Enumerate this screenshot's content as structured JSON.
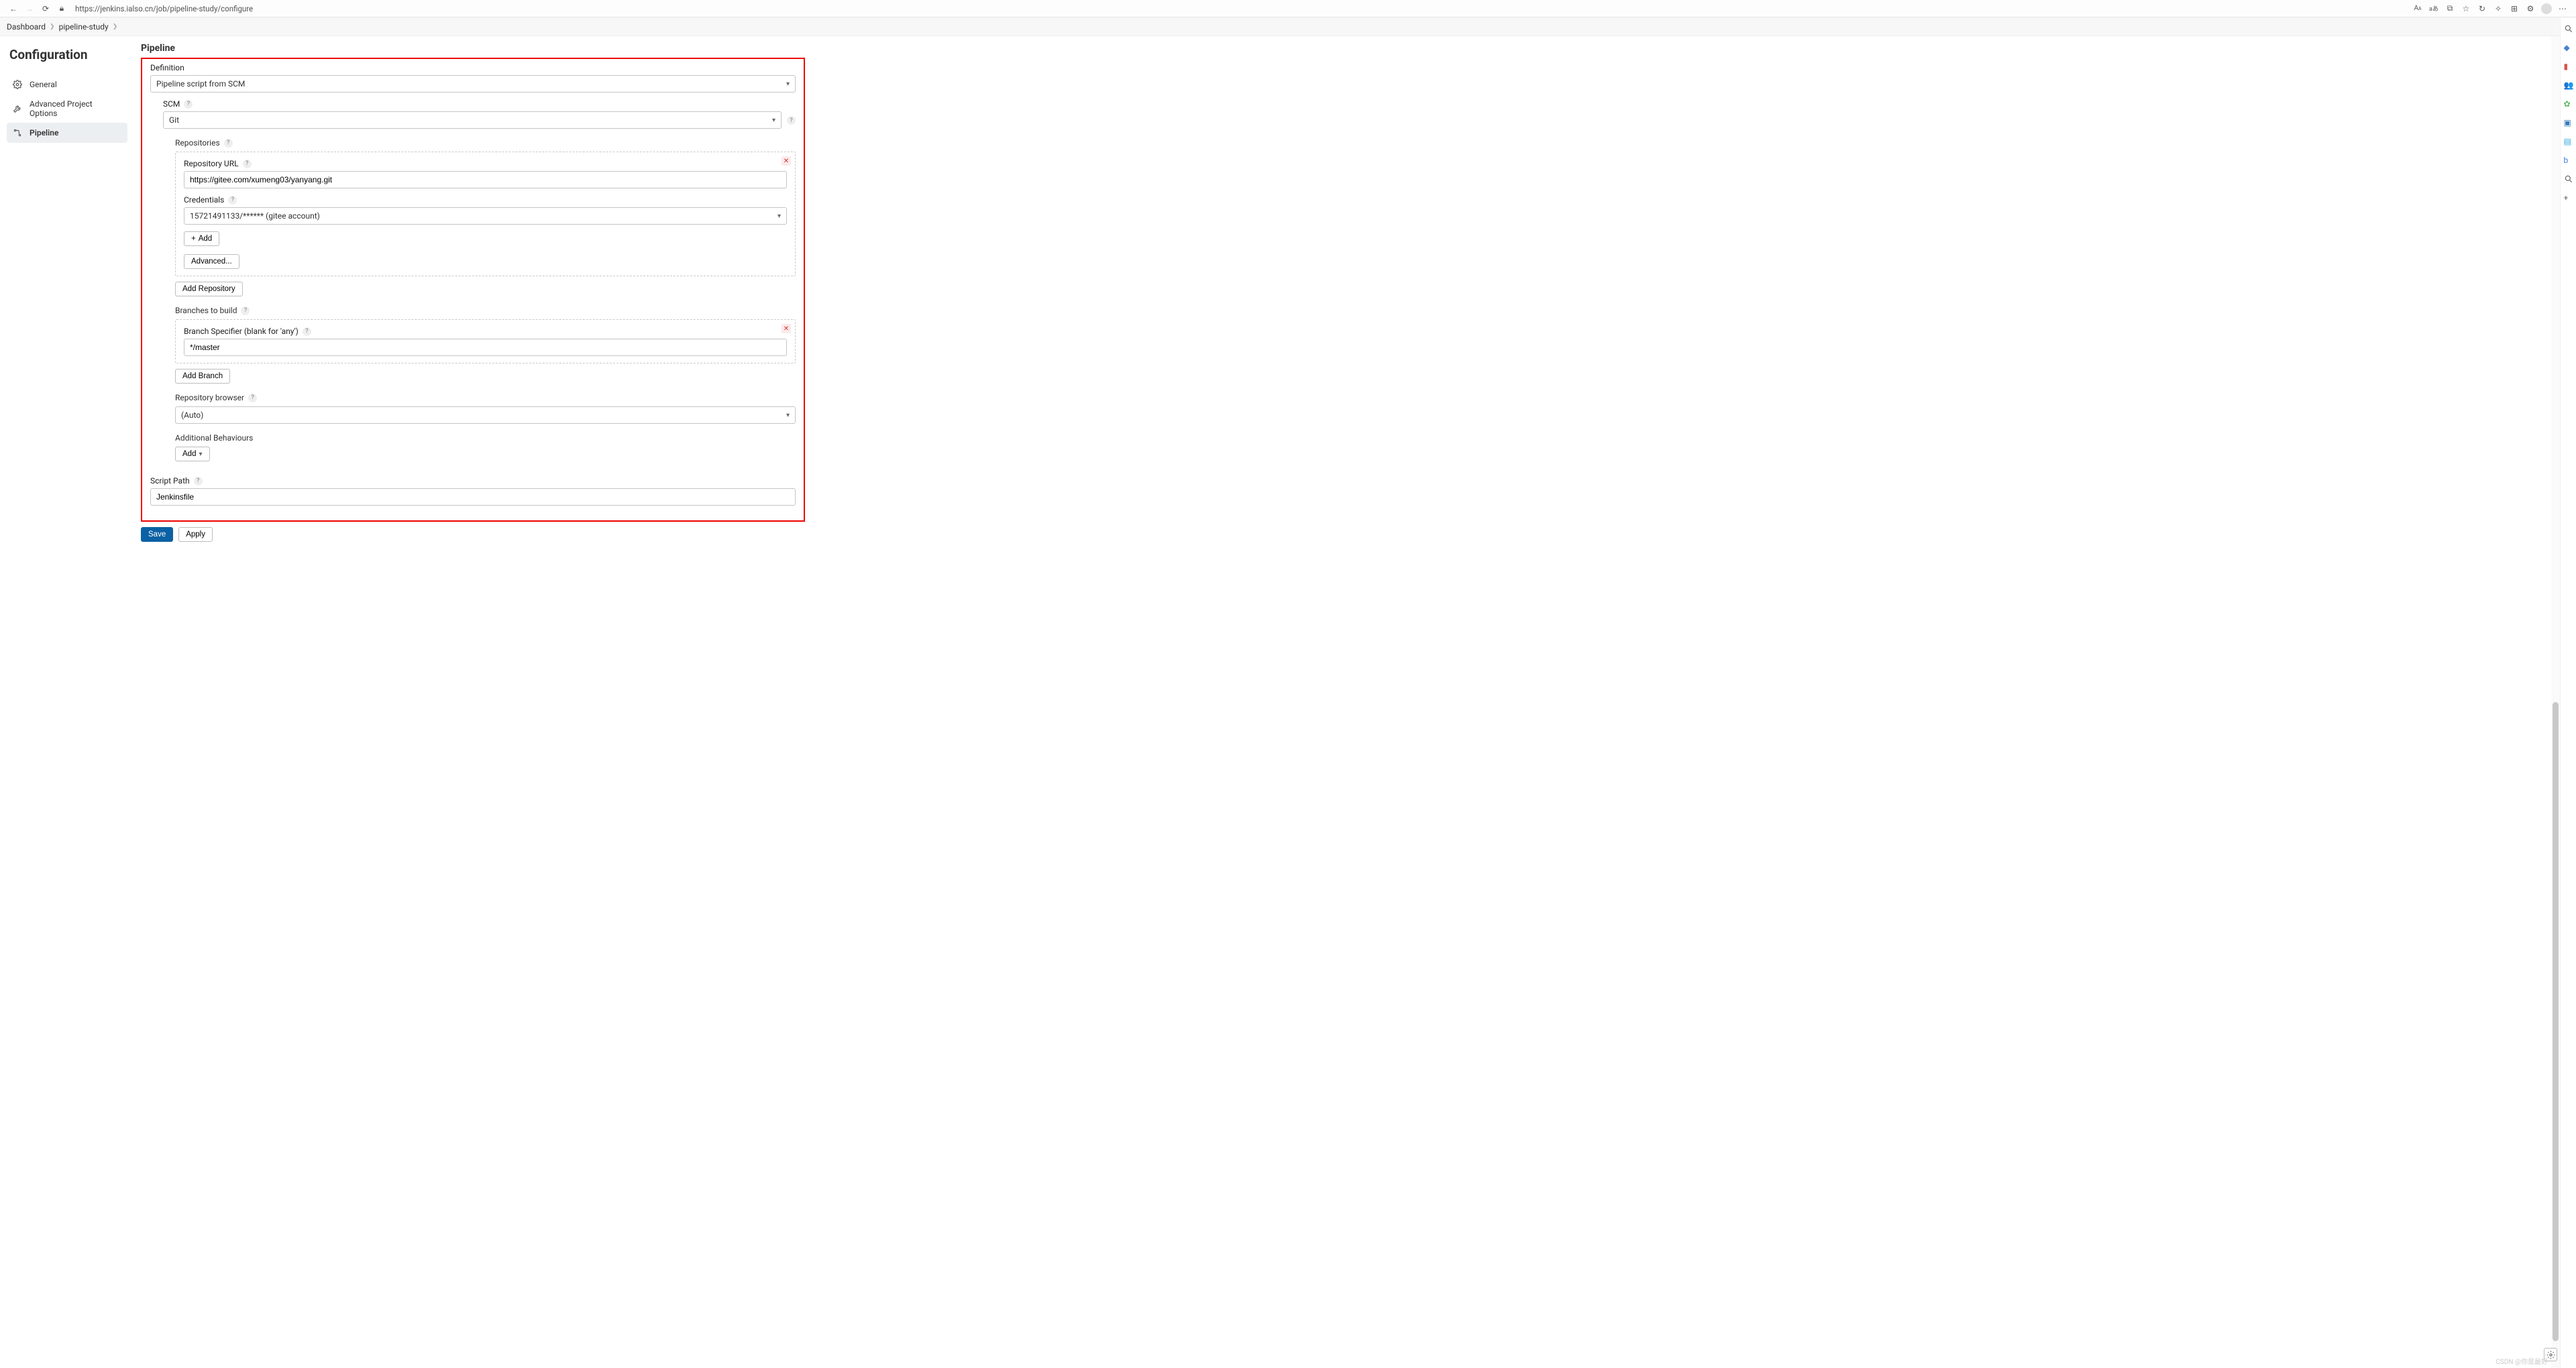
{
  "browser": {
    "url": "https://jenkins.ialso.cn/job/pipeline-study/configure"
  },
  "breadcrumb": {
    "dashboard": "Dashboard",
    "job": "pipeline-study"
  },
  "sidebar": {
    "title": "Configuration",
    "general": "General",
    "advanced": "Advanced Project Options",
    "pipeline": "Pipeline"
  },
  "section": {
    "pipeline_heading": "Pipeline",
    "definition_label": "Definition",
    "definition_value": "Pipeline script from SCM",
    "scm_label": "SCM",
    "scm_value": "Git",
    "repositories_label": "Repositories",
    "repo_url_label": "Repository URL",
    "repo_url_value": "https://gitee.com/xumeng03/yanyang.git",
    "credentials_label": "Credentials",
    "credentials_value": "15721491133/****** (gitee account)",
    "add_btn": "Add",
    "advanced_btn": "Advanced...",
    "add_repo_btn": "Add Repository",
    "branches_label": "Branches to build",
    "branch_spec_label": "Branch Specifier (blank for 'any')",
    "branch_spec_value": "*/master",
    "add_branch_btn": "Add Branch",
    "repo_browser_label": "Repository browser",
    "repo_browser_value": "(Auto)",
    "additional_beh_label": "Additional Behaviours",
    "add_beh_btn": "Add",
    "script_path_label": "Script Path",
    "script_path_value": "Jenkinsfile"
  },
  "footer": {
    "save": "Save",
    "apply": "Apply",
    "watermark": "CSDN @你是最好"
  }
}
